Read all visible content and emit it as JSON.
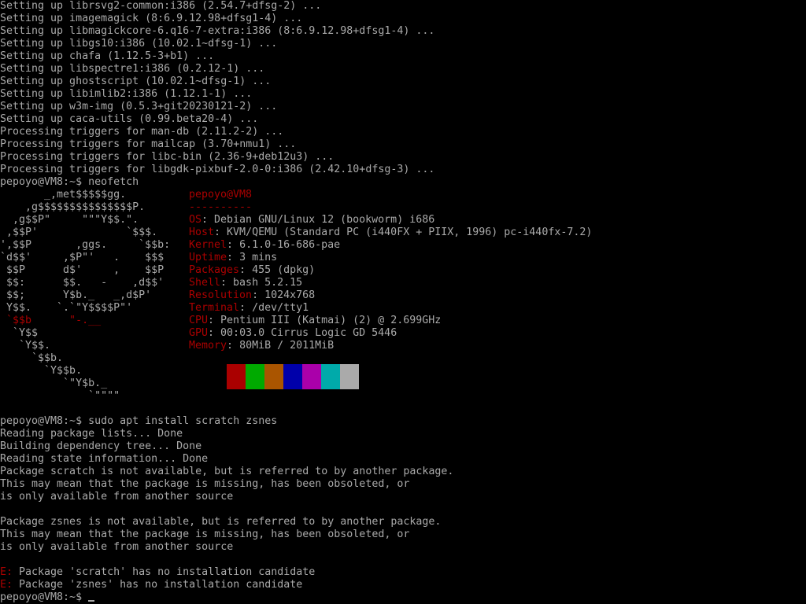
{
  "terminal": {
    "setup_lines": [
      "Setting up librsvg2-common:i386 (2.54.7+dfsg-2) ...",
      "Setting up imagemagick (8:6.9.12.98+dfsg1-4) ...",
      "Setting up libmagickcore-6.q16-7-extra:i386 (8:6.9.12.98+dfsg1-4) ...",
      "Setting up libgs10:i386 (10.02.1~dfsg-1) ...",
      "Setting up chafa (1.12.5-3+b1) ...",
      "Setting up libspectre1:i386 (0.2.12-1) ...",
      "Setting up ghostscript (10.02.1~dfsg-1) ...",
      "Setting up libimlib2:i386 (1.12.1-1) ...",
      "Setting up w3m-img (0.5.3+git20230121-2) ...",
      "Setting up caca-utils (0.99.beta20-4) ...",
      "Processing triggers for man-db (2.11.2-2) ...",
      "Processing triggers for mailcap (3.70+nmu1) ...",
      "Processing triggers for libc-bin (2.36-9+deb12u3) ...",
      "Processing triggers for libgdk-pixbuf-2.0-0:i386 (2.42.10+dfsg-3) ..."
    ],
    "prompt": "pepoyo@VM8:~$ ",
    "neofetch_command": "neofetch",
    "logo_lines": [
      "       _,met$$$$$gg.",
      "    ,g$$$$$$$$$$$$$$$P.",
      "  ,g$$P\"     \"\"\"Y$$.\".",
      " ,$$P'              `$$$.",
      "',$$P       ,ggs.     `$$b:",
      "`d$$'     ,$P\"'   .    $$$",
      " $$P      d$'     ,    $$P",
      " $$:      $$.   -    ,d$$'",
      " $$;      Y$b._   _,d$P'",
      " Y$$.    `.`\"Y$$$$P\"'",
      " `$$b      \"-.__",
      "  `Y$$",
      "   `Y$$.",
      "     `$$b.",
      "       `Y$$b.",
      "          `\"Y$b._",
      "              `\"\"\"\""
    ],
    "neofetch": {
      "user_host": "pepoyo@VM8",
      "separator": "----------",
      "info": [
        {
          "label": "OS",
          "value": "Debian GNU/Linux 12 (bookworm) i686"
        },
        {
          "label": "Host",
          "value": "KVM/QEMU (Standard PC (i440FX + PIIX, 1996) pc-i440fx-7.2)"
        },
        {
          "label": "Kernel",
          "value": "6.1.0-16-686-pae"
        },
        {
          "label": "Uptime",
          "value": "3 mins"
        },
        {
          "label": "Packages",
          "value": "455 (dpkg)"
        },
        {
          "label": "Shell",
          "value": "bash 5.2.15"
        },
        {
          "label": "Resolution",
          "value": "1024x768"
        },
        {
          "label": "Terminal",
          "value": "/dev/tty1"
        },
        {
          "label": "CPU",
          "value": "Pentium III (Katmai) (2) @ 2.699GHz"
        },
        {
          "label": "GPU",
          "value": "00:03.0 Cirrus Logic GD 5446"
        },
        {
          "label": "Memory",
          "value": "80MiB / 2011MiB"
        }
      ],
      "swatch_colors": [
        "#000000",
        "#aa0000",
        "#00aa00",
        "#aa5500",
        "#0000aa",
        "#aa00aa",
        "#00aaaa",
        "#aaaaaa"
      ]
    },
    "apt_command": "sudo apt install scratch zsnes",
    "apt_output": [
      "Reading package lists... Done",
      "Building dependency tree... Done",
      "Reading state information... Done",
      "Package scratch is not available, but is referred to by another package.",
      "This may mean that the package is missing, has been obsoleted, or",
      "is only available from another source",
      "",
      "Package zsnes is not available, but is referred to by another package.",
      "This may mean that the package is missing, has been obsoleted, or",
      "is only available from another source",
      ""
    ],
    "errors": [
      {
        "prefix": "E:",
        "message": " Package 'scratch' has no installation candidate"
      },
      {
        "prefix": "E:",
        "message": " Package 'zsnes' has no installation candidate"
      }
    ],
    "colors": {
      "background": "#000000",
      "foreground": "#aaaaaa",
      "accent": "#aa0000"
    }
  }
}
